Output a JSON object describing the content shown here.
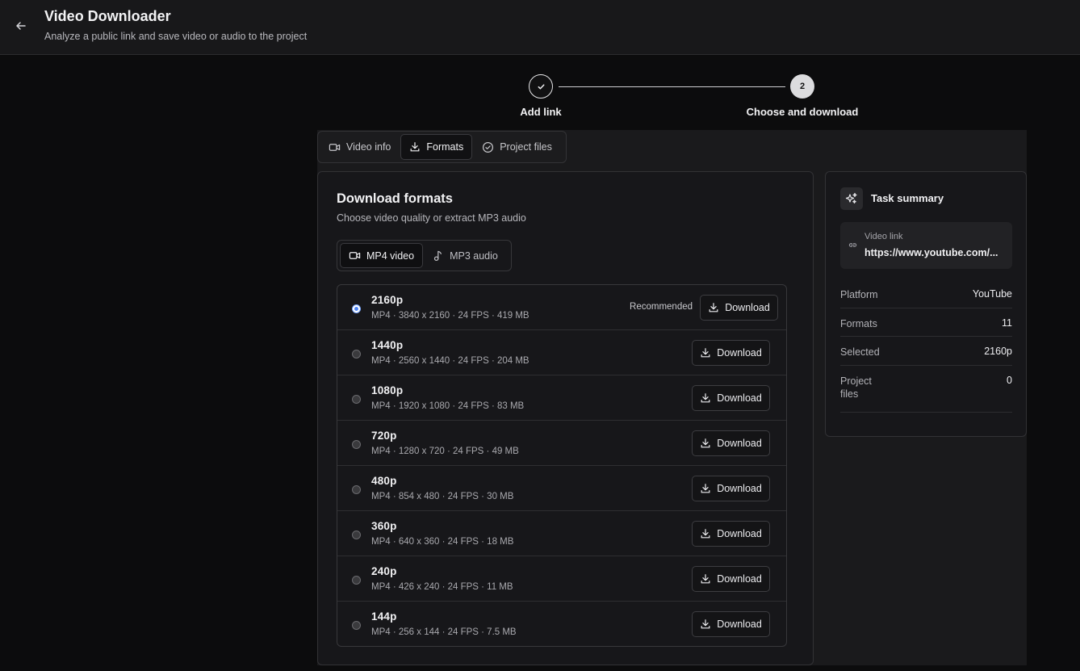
{
  "header": {
    "title": "Video Downloader",
    "subtitle": "Analyze a public link and save video or audio to the project"
  },
  "stepper": {
    "step1_label": "Add link",
    "step2_number": "2",
    "step2_label": "Choose and download"
  },
  "tabs": [
    {
      "label": "Video info",
      "icon": "video-camera-icon"
    },
    {
      "label": "Formats",
      "icon": "download-icon"
    },
    {
      "label": "Project files",
      "icon": "check-circle-icon"
    }
  ],
  "formats_card": {
    "title": "Download formats",
    "subtitle": "Choose video quality or extract MP3 audio",
    "type_tabs": [
      {
        "label": "MP4 video",
        "icon": "video-camera-icon"
      },
      {
        "label": "MP3 audio",
        "icon": "music-note-icon"
      }
    ],
    "recommended_label": "Recommended",
    "download_label": "Download",
    "rows": [
      {
        "res": "2160p",
        "meta": "MP4 · 3840 x 2160 · 24 FPS · 419 MB"
      },
      {
        "res": "1440p",
        "meta": "MP4 · 2560 x 1440 · 24 FPS · 204 MB"
      },
      {
        "res": "1080p",
        "meta": "MP4 · 1920 x 1080 · 24 FPS · 83 MB"
      },
      {
        "res": "720p",
        "meta": "MP4 · 1280 x 720 · 24 FPS · 49 MB"
      },
      {
        "res": "480p",
        "meta": "MP4 · 854 x 480 · 24 FPS · 30 MB"
      },
      {
        "res": "360p",
        "meta": "MP4 · 640 x 360 · 24 FPS · 18 MB"
      },
      {
        "res": "240p",
        "meta": "MP4 · 426 x 240 · 24 FPS · 11 MB"
      },
      {
        "res": "144p",
        "meta": "MP4 · 256 x 144 · 24 FPS · 7.5 MB"
      }
    ]
  },
  "summary": {
    "title": "Task summary",
    "link_label": "Video link",
    "link_value": "https://www.youtube.com/...",
    "rows": [
      {
        "key": "Platform",
        "value": "YouTube"
      },
      {
        "key": "Formats",
        "value": "11"
      },
      {
        "key": "Selected",
        "value": "2160p"
      },
      {
        "key": "Project files",
        "value": "0"
      }
    ]
  },
  "colors": {
    "background": "#0c0c0d",
    "header": "#18181a",
    "card": "#17171a",
    "accent_radio": "#4d84f5"
  }
}
